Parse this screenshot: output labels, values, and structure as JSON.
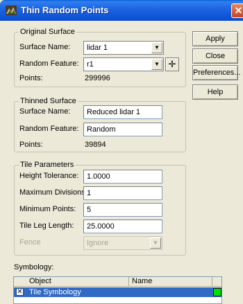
{
  "window": {
    "title": "Thin Random Points",
    "close_glyph": "✕"
  },
  "original_surface": {
    "legend": "Original Surface",
    "surface_name_label": "Surface Name:",
    "surface_name_value": "lidar 1",
    "random_feature_label": "Random Feature:",
    "random_feature_value": "r1",
    "points_label": "Points:",
    "points_value": "299996"
  },
  "thinned_surface": {
    "legend": "Thinned Surface",
    "surface_name_label": "Surface Name:",
    "surface_name_value": "Reduced lidar 1",
    "random_feature_label": "Random Feature:",
    "random_feature_value": "Random",
    "points_label": "Points:",
    "points_value": "39894"
  },
  "tile_parameters": {
    "legend": "Tile Parameters",
    "height_tolerance_label": "Height Tolerance:",
    "height_tolerance_value": "1.0000",
    "max_divisions_label": "Maximum Divisions:",
    "max_divisions_value": "1",
    "min_points_label": "Minimum Points:",
    "min_points_value": "5",
    "tile_leg_length_label": "Tile Leg Length:",
    "tile_leg_length_value": "25.0000",
    "fence_label": "Fence",
    "fence_value": "Ignore"
  },
  "buttons": {
    "apply": "Apply",
    "close": "Close",
    "preferences": "Preferences...",
    "help": "Help"
  },
  "symbology": {
    "label": "Symbology:",
    "columns": [
      "Object",
      "Name"
    ],
    "rows": [
      {
        "checked": true,
        "object": "Tile Symbology",
        "name": "",
        "color": "#00e000"
      }
    ]
  },
  "colors": {
    "titlebar": "#0d54d6",
    "selection": "#316ac5",
    "swatch": "#00e000"
  },
  "icons": {
    "combo_arrow": "▼",
    "locate": "✛",
    "check": "✕"
  }
}
